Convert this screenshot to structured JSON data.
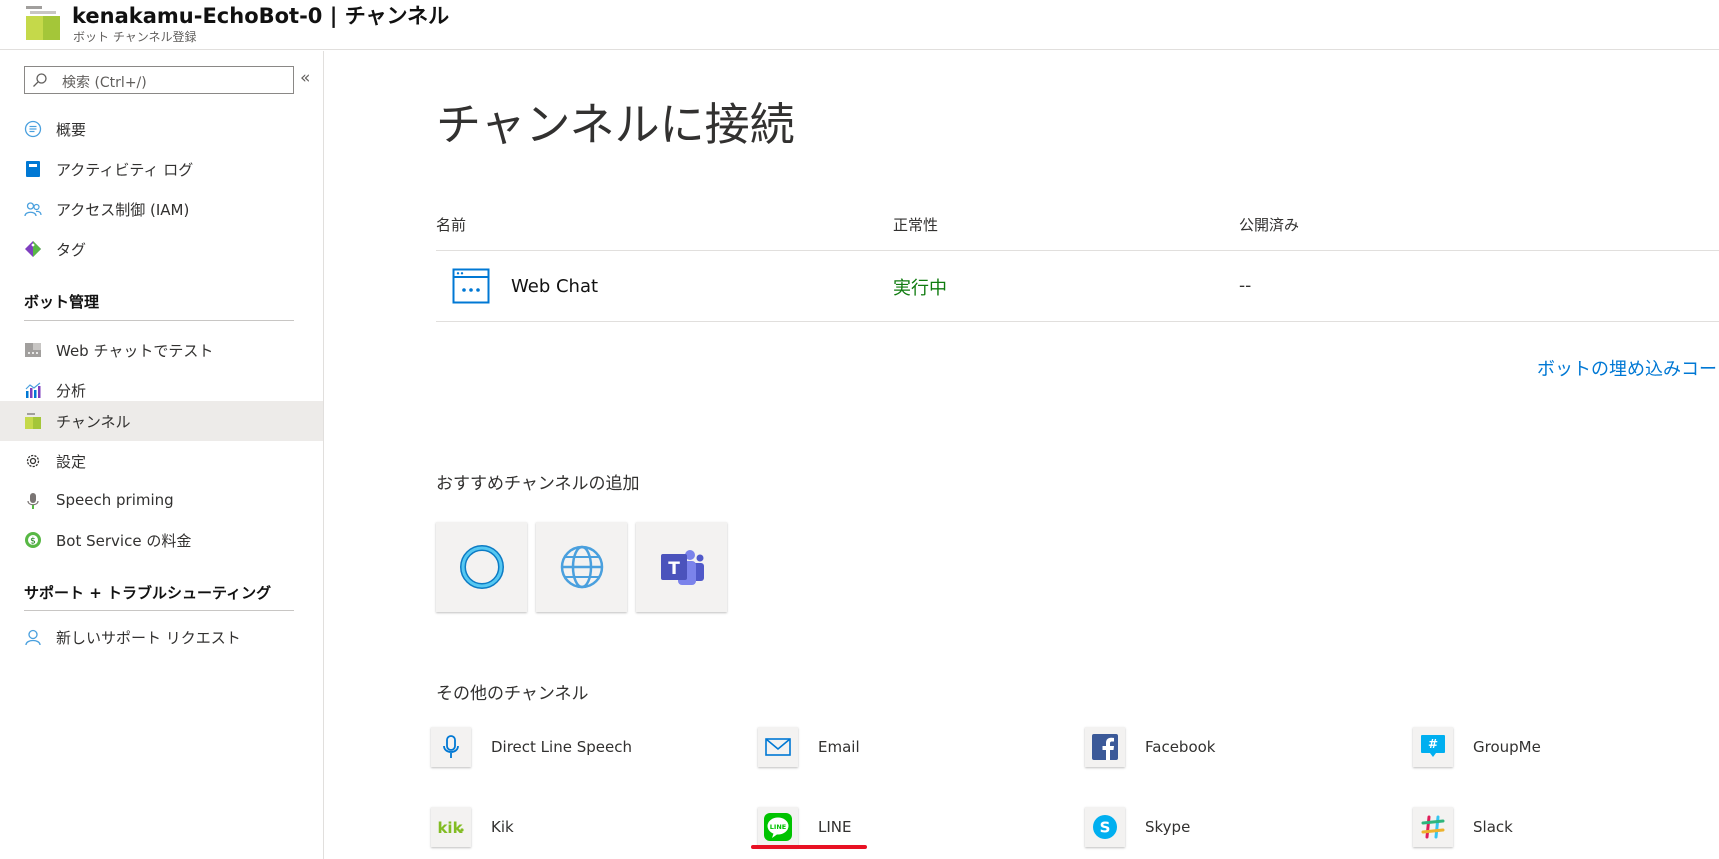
{
  "header": {
    "title": "kenakamu-EchoBot-0 | チャンネル",
    "subtitle": "ボット チャンネル登録",
    "logo_icon": "bot-channels-icon"
  },
  "sidebar": {
    "search_placeholder": "検索 (Ctrl+/)",
    "collapse_label": "«",
    "items": [
      {
        "label": "概要",
        "icon": "overview-icon"
      },
      {
        "label": "アクティビティ ログ",
        "icon": "activity-log-icon"
      },
      {
        "label": "アクセス制御 (IAM)",
        "icon": "iam-icon"
      },
      {
        "label": "タグ",
        "icon": "tag-icon"
      }
    ],
    "section_bot": "ボット管理",
    "bot_items": [
      {
        "label": "Web チャットでテスト",
        "icon": "webchat-test-icon"
      },
      {
        "label": "分析",
        "icon": "analytics-icon"
      },
      {
        "label": "チャンネル",
        "icon": "channels-icon",
        "selected": true
      },
      {
        "label": "設定",
        "icon": "settings-gear-icon"
      },
      {
        "label": "Speech priming",
        "icon": "speech-priming-icon"
      },
      {
        "label": "Bot Service の料金",
        "icon": "pricing-icon"
      }
    ],
    "section_support": "サポート + トラブルシューティング",
    "support_items": [
      {
        "label": "新しいサポート リクエスト",
        "icon": "support-request-icon"
      }
    ]
  },
  "main": {
    "title": "チャンネルに接続",
    "columns": {
      "name": "名前",
      "health": "正常性",
      "published": "公開済み"
    },
    "rows": [
      {
        "name": "Web Chat",
        "health": "実行中",
        "published": "--"
      }
    ],
    "embed_link": "ボットの埋め込みコード",
    "featured_title": "おすすめチャンネルの追加",
    "featured": [
      "cortana-icon",
      "web-globe-icon",
      "teams-icon"
    ],
    "other_title": "その他のチャンネル",
    "other_channels": [
      {
        "label": "Direct Line Speech",
        "icon": "direct-line-speech-icon"
      },
      {
        "label": "Email",
        "icon": "email-icon"
      },
      {
        "label": "Facebook",
        "icon": "facebook-icon"
      },
      {
        "label": "GroupMe",
        "icon": "groupme-icon"
      },
      {
        "label": "Kik",
        "icon": "kik-icon"
      },
      {
        "label": "LINE",
        "icon": "line-icon"
      },
      {
        "label": "Skype",
        "icon": "skype-icon"
      },
      {
        "label": "Slack",
        "icon": "slack-icon"
      }
    ]
  },
  "colors": {
    "link": "#0078d4",
    "running": "#107c10",
    "highlight": "#e81123",
    "selected_bg": "#edebe9"
  }
}
